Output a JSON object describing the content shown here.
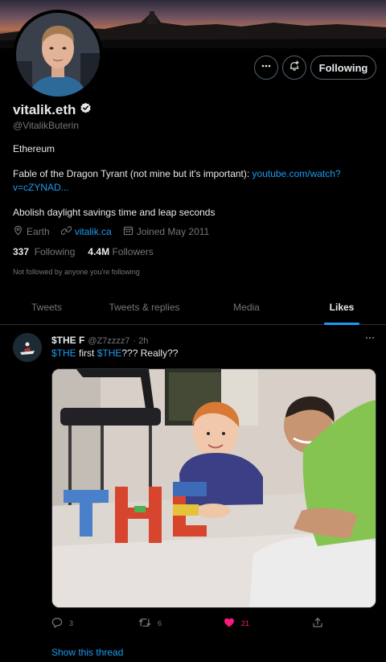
{
  "profile": {
    "display_name": "vitalik.eth",
    "handle": "@VitalikButerin",
    "bio_line1": "Ethereum",
    "bio_line2_text": "Fable of the Dragon Tyrant (not mine but it's important): ",
    "bio_line2_link": "youtube.com/watch?",
    "bio_line2_link_cont": "v=cZYNAD...",
    "bio_line3": "Abolish daylight savings time and leap seconds",
    "location": "Earth",
    "website": "vitalik.ca",
    "joined": "Joined May 2011",
    "following_count": "337",
    "following_label": "Following",
    "followers_count": "4.4M",
    "followers_label": "Followers",
    "not_followed": "Not followed by anyone you're following"
  },
  "actions": {
    "more_icon": "more-horizontal-icon",
    "notify_icon": "bell-plus-icon",
    "follow_label": "Following"
  },
  "tabs": [
    {
      "label": "Tweets",
      "active": false
    },
    {
      "label": "Tweets & replies",
      "active": false
    },
    {
      "label": "Media",
      "active": false
    },
    {
      "label": "Likes",
      "active": true
    }
  ],
  "tweet": {
    "author": "$THE F",
    "handle": "@Z7zzzz7",
    "time": "· 2h",
    "text_cashtag1": "$THE",
    "text_mid": " first ",
    "text_cashtag2": "$THE",
    "text_end": "??? Really??",
    "reply_count": "3",
    "retweet_count": "6",
    "like_count": "21",
    "show_thread": "Show this thread"
  },
  "colors": {
    "accent": "#1d9bf0",
    "like": "#f91880",
    "muted": "#71767b",
    "text": "#e7e9ea",
    "border": "#2f3336"
  }
}
